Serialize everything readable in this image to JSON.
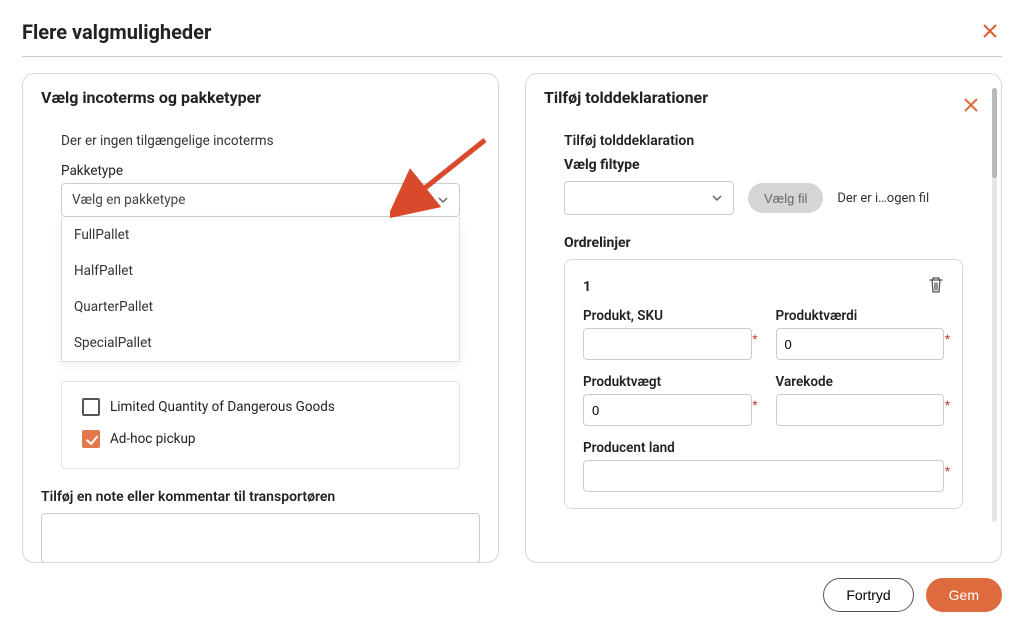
{
  "modal": {
    "title": "Flere valgmuligheder"
  },
  "left": {
    "title": "Vælg incoterms og pakketyper",
    "no_incoterms": "Der er ingen tilgængelige incoterms",
    "package_label": "Pakketype",
    "package_placeholder": "Vælg en pakketype",
    "package_options": [
      "FullPallet",
      "HalfPallet",
      "QuarterPallet",
      "SpecialPallet"
    ],
    "chk_lq": "Limited Quantity of Dangerous Goods",
    "chk_adhoc": "Ad-hoc pickup",
    "note_label": "Tilføj en note eller kommentar til transportøren"
  },
  "right": {
    "title": "Tilføj tolddeklarationer",
    "section": "Tilføj tolddeklaration",
    "filetype_label": "Vælg filtype",
    "choose_file": "Vælg fil",
    "file_status": "Der er i…ogen fil",
    "orderlines_label": "Ordrelinjer",
    "ol_index": "1",
    "f_sku": "Produkt, SKU",
    "f_value": "Produktværdi",
    "f_weight": "Produktvægt",
    "f_code": "Varekode",
    "f_country": "Producent land",
    "v_value": "0",
    "v_weight": "0"
  },
  "footer": {
    "cancel": "Fortryd",
    "save": "Gem"
  }
}
